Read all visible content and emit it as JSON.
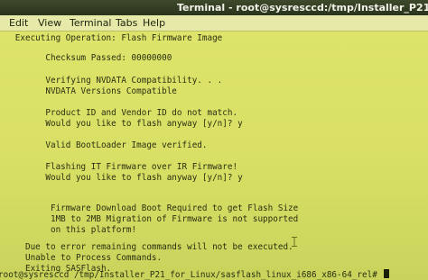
{
  "window": {
    "title": "Terminal - root@sysresccd:/tmp/Installer_P21_for_Linux/sasfla"
  },
  "menu": {
    "items": [
      "Edit",
      "View",
      "Terminal",
      "Tabs",
      "Help"
    ]
  },
  "terminal": {
    "lines": [
      "   Executing Operation: Flash Firmware Image",
      "",
      "         Checksum Passed: 00000000",
      "",
      "         Verifying NVDATA Compatibility. . .",
      "         NVDATA Versions Compatible",
      "",
      "         Product ID and Vendor ID do not match.",
      "         Would you like to flash anyway [y/n]? y",
      "",
      "         Valid BootLoader Image verified.",
      "",
      "         Flashing IT Firmware over IR Firmware!",
      "         Would you like to flash anyway [y/n]? y",
      "",
      "",
      "          Firmware Download Boot Required to get Flash Size",
      "          1MB to 2MB Migration of Firmware is not supported",
      "          on this platform!",
      "",
      "     Due to error remaining commands will not be executed.",
      "     Unable to Process Commands.",
      "     Exiting SASFlash.",
      "root@sysresccd /tmp/Installer_P21_for_Linux/sasflash_linux_i686_x86-64_rel# "
    ]
  }
}
